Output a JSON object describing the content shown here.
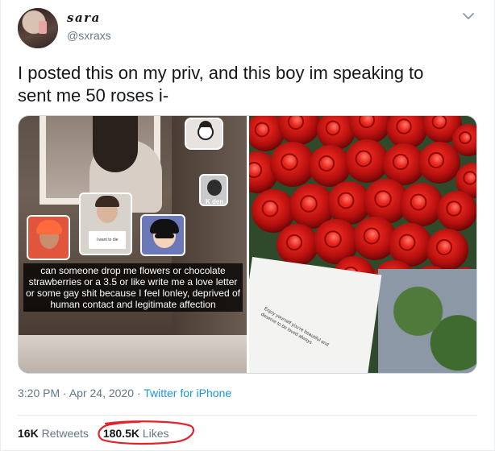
{
  "user": {
    "display_name": "sara",
    "handle": "@sxraxs",
    "avatar_icon": "profile-photo"
  },
  "menu": {
    "icon": "chevron-down-icon"
  },
  "tweet": {
    "text": "I posted this on my priv, and this boy im speaking to\nsent me 50 roses i-"
  },
  "media": {
    "left": {
      "caption": "can someone drop me flowers or chocolate strawberries or a 3.5 or like write me a love letter or some gay shit because I feel lonley, deprived of human contact and legitimate affection",
      "sticker_label": "K den",
      "sign_text": "I want to die"
    },
    "right": {
      "card_text": "Enjoy yourself you're beautiful and deserve to be loved always"
    }
  },
  "meta": {
    "time": "3:20 PM",
    "date": "Apr 24, 2020",
    "separator": "·",
    "source": "Twitter for iPhone"
  },
  "stats": {
    "retweets_count": "16K",
    "retweets_label": "Retweets",
    "likes_count": "180.5K",
    "likes_label": "Likes"
  },
  "colors": {
    "link": "#1b95e0",
    "secondary_text": "#657786",
    "annotation_circle": "#e0242a"
  }
}
